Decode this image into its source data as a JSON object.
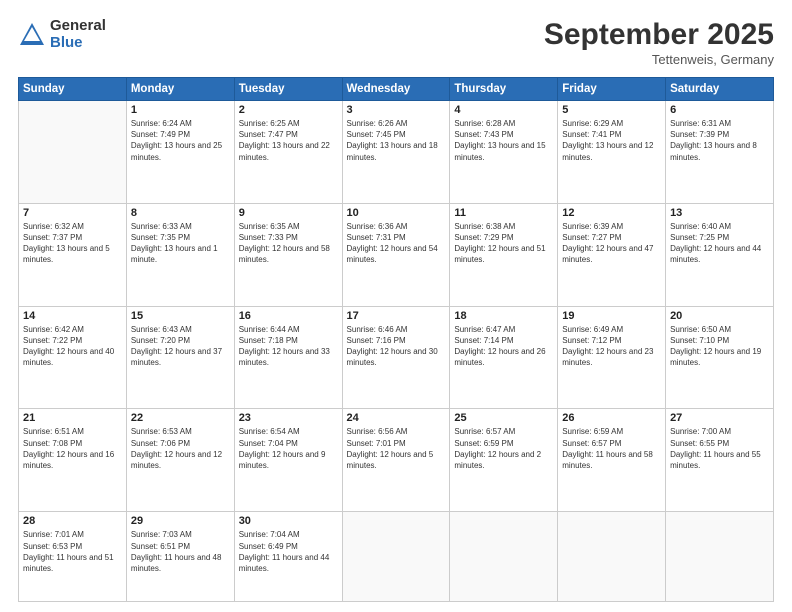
{
  "logo": {
    "general": "General",
    "blue": "Blue"
  },
  "header": {
    "month": "September 2025",
    "location": "Tettenweis, Germany"
  },
  "weekdays": [
    "Sunday",
    "Monday",
    "Tuesday",
    "Wednesday",
    "Thursday",
    "Friday",
    "Saturday"
  ],
  "weeks": [
    [
      {
        "day": "",
        "sunrise": "",
        "sunset": "",
        "daylight": ""
      },
      {
        "day": "1",
        "sunrise": "Sunrise: 6:24 AM",
        "sunset": "Sunset: 7:49 PM",
        "daylight": "Daylight: 13 hours and 25 minutes."
      },
      {
        "day": "2",
        "sunrise": "Sunrise: 6:25 AM",
        "sunset": "Sunset: 7:47 PM",
        "daylight": "Daylight: 13 hours and 22 minutes."
      },
      {
        "day": "3",
        "sunrise": "Sunrise: 6:26 AM",
        "sunset": "Sunset: 7:45 PM",
        "daylight": "Daylight: 13 hours and 18 minutes."
      },
      {
        "day": "4",
        "sunrise": "Sunrise: 6:28 AM",
        "sunset": "Sunset: 7:43 PM",
        "daylight": "Daylight: 13 hours and 15 minutes."
      },
      {
        "day": "5",
        "sunrise": "Sunrise: 6:29 AM",
        "sunset": "Sunset: 7:41 PM",
        "daylight": "Daylight: 13 hours and 12 minutes."
      },
      {
        "day": "6",
        "sunrise": "Sunrise: 6:31 AM",
        "sunset": "Sunset: 7:39 PM",
        "daylight": "Daylight: 13 hours and 8 minutes."
      }
    ],
    [
      {
        "day": "7",
        "sunrise": "Sunrise: 6:32 AM",
        "sunset": "Sunset: 7:37 PM",
        "daylight": "Daylight: 13 hours and 5 minutes."
      },
      {
        "day": "8",
        "sunrise": "Sunrise: 6:33 AM",
        "sunset": "Sunset: 7:35 PM",
        "daylight": "Daylight: 13 hours and 1 minute."
      },
      {
        "day": "9",
        "sunrise": "Sunrise: 6:35 AM",
        "sunset": "Sunset: 7:33 PM",
        "daylight": "Daylight: 12 hours and 58 minutes."
      },
      {
        "day": "10",
        "sunrise": "Sunrise: 6:36 AM",
        "sunset": "Sunset: 7:31 PM",
        "daylight": "Daylight: 12 hours and 54 minutes."
      },
      {
        "day": "11",
        "sunrise": "Sunrise: 6:38 AM",
        "sunset": "Sunset: 7:29 PM",
        "daylight": "Daylight: 12 hours and 51 minutes."
      },
      {
        "day": "12",
        "sunrise": "Sunrise: 6:39 AM",
        "sunset": "Sunset: 7:27 PM",
        "daylight": "Daylight: 12 hours and 47 minutes."
      },
      {
        "day": "13",
        "sunrise": "Sunrise: 6:40 AM",
        "sunset": "Sunset: 7:25 PM",
        "daylight": "Daylight: 12 hours and 44 minutes."
      }
    ],
    [
      {
        "day": "14",
        "sunrise": "Sunrise: 6:42 AM",
        "sunset": "Sunset: 7:22 PM",
        "daylight": "Daylight: 12 hours and 40 minutes."
      },
      {
        "day": "15",
        "sunrise": "Sunrise: 6:43 AM",
        "sunset": "Sunset: 7:20 PM",
        "daylight": "Daylight: 12 hours and 37 minutes."
      },
      {
        "day": "16",
        "sunrise": "Sunrise: 6:44 AM",
        "sunset": "Sunset: 7:18 PM",
        "daylight": "Daylight: 12 hours and 33 minutes."
      },
      {
        "day": "17",
        "sunrise": "Sunrise: 6:46 AM",
        "sunset": "Sunset: 7:16 PM",
        "daylight": "Daylight: 12 hours and 30 minutes."
      },
      {
        "day": "18",
        "sunrise": "Sunrise: 6:47 AM",
        "sunset": "Sunset: 7:14 PM",
        "daylight": "Daylight: 12 hours and 26 minutes."
      },
      {
        "day": "19",
        "sunrise": "Sunrise: 6:49 AM",
        "sunset": "Sunset: 7:12 PM",
        "daylight": "Daylight: 12 hours and 23 minutes."
      },
      {
        "day": "20",
        "sunrise": "Sunrise: 6:50 AM",
        "sunset": "Sunset: 7:10 PM",
        "daylight": "Daylight: 12 hours and 19 minutes."
      }
    ],
    [
      {
        "day": "21",
        "sunrise": "Sunrise: 6:51 AM",
        "sunset": "Sunset: 7:08 PM",
        "daylight": "Daylight: 12 hours and 16 minutes."
      },
      {
        "day": "22",
        "sunrise": "Sunrise: 6:53 AM",
        "sunset": "Sunset: 7:06 PM",
        "daylight": "Daylight: 12 hours and 12 minutes."
      },
      {
        "day": "23",
        "sunrise": "Sunrise: 6:54 AM",
        "sunset": "Sunset: 7:04 PM",
        "daylight": "Daylight: 12 hours and 9 minutes."
      },
      {
        "day": "24",
        "sunrise": "Sunrise: 6:56 AM",
        "sunset": "Sunset: 7:01 PM",
        "daylight": "Daylight: 12 hours and 5 minutes."
      },
      {
        "day": "25",
        "sunrise": "Sunrise: 6:57 AM",
        "sunset": "Sunset: 6:59 PM",
        "daylight": "Daylight: 12 hours and 2 minutes."
      },
      {
        "day": "26",
        "sunrise": "Sunrise: 6:59 AM",
        "sunset": "Sunset: 6:57 PM",
        "daylight": "Daylight: 11 hours and 58 minutes."
      },
      {
        "day": "27",
        "sunrise": "Sunrise: 7:00 AM",
        "sunset": "Sunset: 6:55 PM",
        "daylight": "Daylight: 11 hours and 55 minutes."
      }
    ],
    [
      {
        "day": "28",
        "sunrise": "Sunrise: 7:01 AM",
        "sunset": "Sunset: 6:53 PM",
        "daylight": "Daylight: 11 hours and 51 minutes."
      },
      {
        "day": "29",
        "sunrise": "Sunrise: 7:03 AM",
        "sunset": "Sunset: 6:51 PM",
        "daylight": "Daylight: 11 hours and 48 minutes."
      },
      {
        "day": "30",
        "sunrise": "Sunrise: 7:04 AM",
        "sunset": "Sunset: 6:49 PM",
        "daylight": "Daylight: 11 hours and 44 minutes."
      },
      {
        "day": "",
        "sunrise": "",
        "sunset": "",
        "daylight": ""
      },
      {
        "day": "",
        "sunrise": "",
        "sunset": "",
        "daylight": ""
      },
      {
        "day": "",
        "sunrise": "",
        "sunset": "",
        "daylight": ""
      },
      {
        "day": "",
        "sunrise": "",
        "sunset": "",
        "daylight": ""
      }
    ]
  ]
}
